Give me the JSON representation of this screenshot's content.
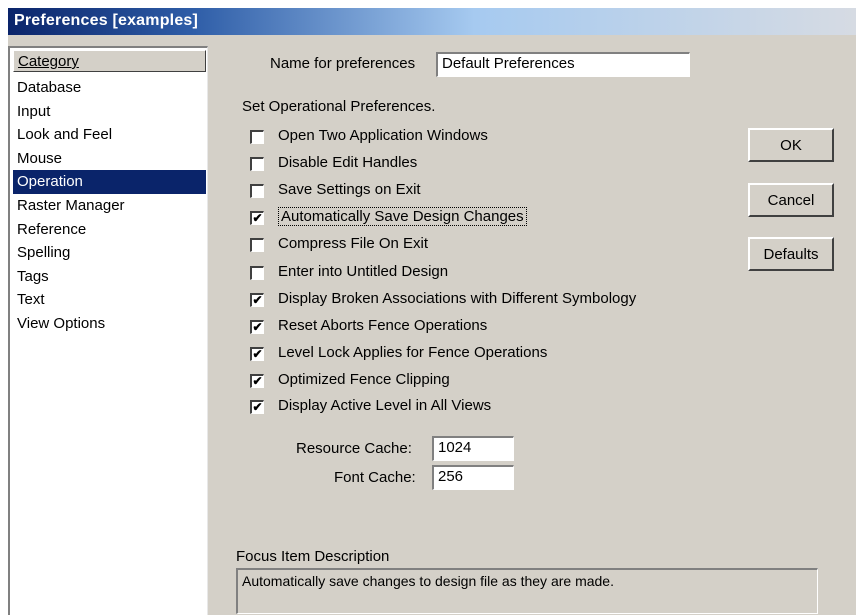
{
  "window": {
    "title": "Preferences [examples]"
  },
  "sidebar": {
    "header": "Category",
    "items": [
      {
        "label": "Database",
        "selected": false
      },
      {
        "label": "Input",
        "selected": false
      },
      {
        "label": "Look and Feel",
        "selected": false
      },
      {
        "label": "Mouse",
        "selected": false
      },
      {
        "label": "Operation",
        "selected": true
      },
      {
        "label": "Raster Manager",
        "selected": false
      },
      {
        "label": "Reference",
        "selected": false
      },
      {
        "label": "Spelling",
        "selected": false
      },
      {
        "label": "Tags",
        "selected": false
      },
      {
        "label": "Text",
        "selected": false
      },
      {
        "label": "View Options",
        "selected": false
      }
    ]
  },
  "main": {
    "name_label": "Name for preferences",
    "name_value": "Default Preferences",
    "section_label": "Set Operational Preferences.",
    "checkboxes": [
      {
        "label": "Open Two Application Windows",
        "checked": false
      },
      {
        "label": "Disable Edit Handles",
        "checked": false
      },
      {
        "label": "Save Settings on Exit",
        "checked": false
      },
      {
        "label": "Automatically Save Design Changes",
        "checked": true
      },
      {
        "label": "Compress File On Exit",
        "checked": false
      },
      {
        "label": "Enter into Untitled Design",
        "checked": false
      },
      {
        "label": "Display Broken Associations with Different Symbology",
        "checked": true
      },
      {
        "label": "Reset Aborts Fence Operations",
        "checked": true
      },
      {
        "label": "Level Lock Applies for Fence Operations",
        "checked": true
      },
      {
        "label": "Optimized Fence Clipping",
        "checked": true
      },
      {
        "label": "Display Active Level in All Views",
        "checked": true
      }
    ],
    "resource_cache_label": "Resource Cache:",
    "resource_cache_value": "1024",
    "font_cache_label": "Font Cache:",
    "font_cache_value": "256",
    "focus_label": "Focus Item Description",
    "focus_text": "Automatically save changes to design file as they are made."
  },
  "buttons": {
    "ok": "OK",
    "cancel": "Cancel",
    "defaults": "Defaults"
  }
}
